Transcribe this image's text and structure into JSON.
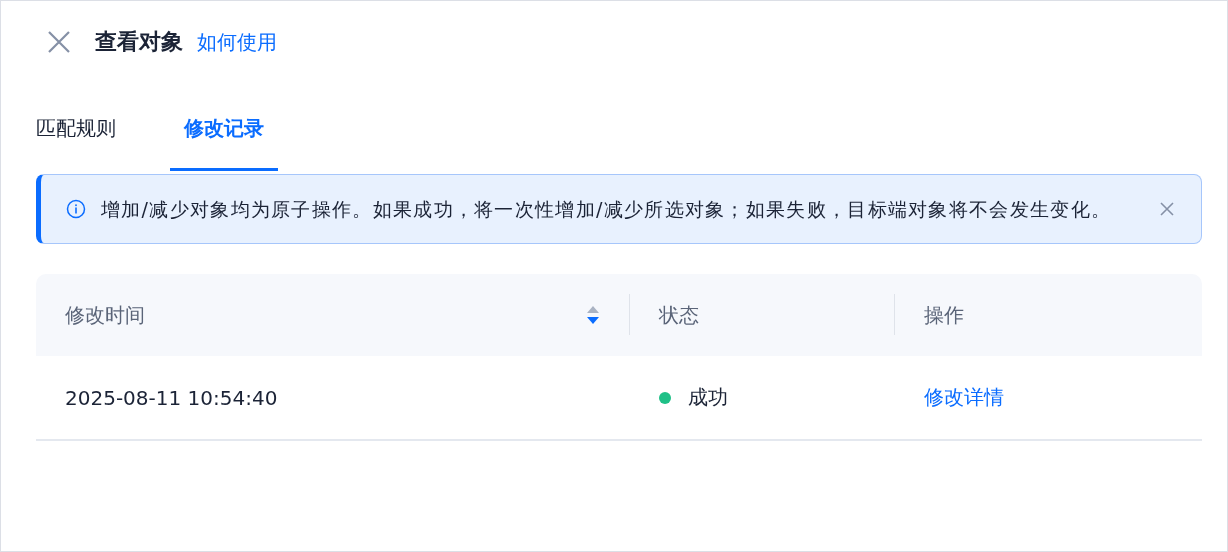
{
  "header": {
    "title": "查看对象",
    "help_link": "如何使用"
  },
  "tabs": [
    {
      "label": "匹配规则",
      "selected": false
    },
    {
      "label": "修改记录",
      "selected": true
    }
  ],
  "alert": {
    "kind": "info",
    "text": "增加/减少对象均为原子操作。如果成功，将一次性增加/减少所选对象；如果失败，目标端对象将不会发生变化。"
  },
  "table": {
    "columns": [
      {
        "label": "修改时间",
        "sort_descending": true
      },
      {
        "label": "状态"
      },
      {
        "label": "操作"
      }
    ],
    "rows": [
      {
        "time": "2025-08-11 10:54:40",
        "status": "成功",
        "color": "#1fc087",
        "action": "修改详情"
      }
    ]
  }
}
